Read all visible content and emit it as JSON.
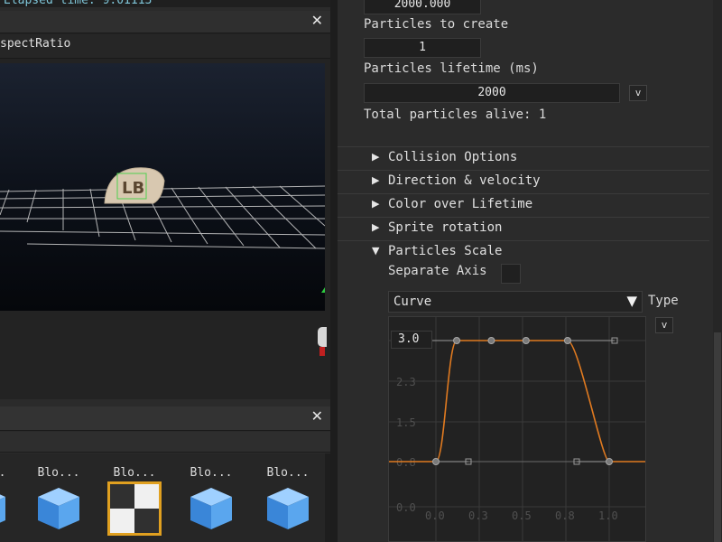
{
  "top_strip": {
    "text": "Elapsed time: 9.01113"
  },
  "scene": {
    "close_glyph": "✕",
    "aspect_label": "spectRatio",
    "billboard_text": "LB"
  },
  "assets": {
    "close_glyph": "✕",
    "items": [
      {
        "name": "Blo...",
        "icon": "cube-icon"
      },
      {
        "name": "Blo...",
        "icon": "cube-icon"
      },
      {
        "name": "Blo...",
        "icon": "checker-texture-icon"
      },
      {
        "name": "Blo...",
        "icon": "cube-icon"
      },
      {
        "name": "Blo...",
        "icon": "cube-icon"
      }
    ]
  },
  "inspector": {
    "top_value": "2000.000",
    "particles_to_create_label": "Particles to create",
    "particles_to_create_value": "1",
    "particles_lifetime_label": "Particles lifetime (ms)",
    "particles_lifetime_value": "2000",
    "small_button_v": "v",
    "total_alive_label": "Total particles alive: 1",
    "sections": [
      {
        "label": "Collision Options",
        "expanded": false
      },
      {
        "label": "Direction & velocity",
        "expanded": false
      },
      {
        "label": "Color over Lifetime",
        "expanded": false
      },
      {
        "label": "Sprite rotation",
        "expanded": false
      },
      {
        "label": "Particles Scale",
        "expanded": true
      }
    ],
    "separate_axis_label": "Separate Axis",
    "separate_axis_checked": false,
    "curve_type_value": "Curve",
    "type_label": "Type",
    "type_button": "v",
    "arrow_collapsed": "▶",
    "arrow_expanded": "▼",
    "dropdown_arrow": "▼"
  },
  "colors": {
    "accent_selection": "#e0a020",
    "curve_color": "#e07a20",
    "background": "#2b2b2b"
  },
  "chart_data": {
    "type": "line",
    "title": "",
    "xlabel": "",
    "ylabel": "",
    "xlim": [
      0.0,
      1.2
    ],
    "ylim": [
      0.0,
      3.0
    ],
    "x_ticks": [
      "0.0",
      "0.3",
      "0.5",
      "0.8",
      "1.0"
    ],
    "y_ticks": [
      "3.0",
      "2.3",
      "1.5",
      "0.8",
      "0.0"
    ],
    "grid": true,
    "series": [
      {
        "keypoints": [
          {
            "x": 0.0,
            "y": 0.8
          },
          {
            "x": 0.12,
            "y": 3.0
          },
          {
            "x": 0.32,
            "y": 3.0
          },
          {
            "x": 0.52,
            "y": 3.0
          },
          {
            "x": 0.76,
            "y": 3.0
          },
          {
            "x": 1.0,
            "y": 0.8
          }
        ]
      }
    ]
  }
}
